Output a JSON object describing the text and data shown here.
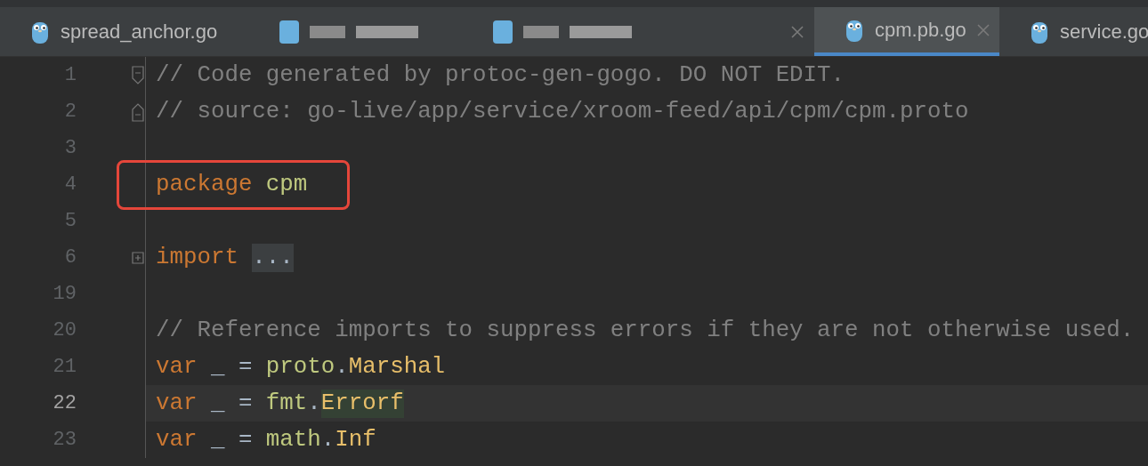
{
  "tabs": [
    {
      "kind": "file",
      "label": "spread_anchor.go",
      "selected": false,
      "closable": false
    },
    {
      "kind": "redacted",
      "selected": false,
      "closable": false
    },
    {
      "kind": "redacted",
      "selected": false,
      "closable": true
    },
    {
      "kind": "file",
      "label": "cpm.pb.go",
      "selected": true,
      "closable": true
    },
    {
      "kind": "file",
      "label": "service.go",
      "selected": false
    }
  ],
  "lines": [
    {
      "number": "1",
      "current": false,
      "fold": {
        "kind": "start"
      },
      "tokens": [
        {
          "kind": "comment",
          "text": "// Code generated by protoc-gen-gogo. DO NOT EDIT."
        }
      ]
    },
    {
      "number": "2",
      "current": false,
      "fold": {
        "kind": "end"
      },
      "tokens": [
        {
          "kind": "comment",
          "text": "// source: go-live/app/service/xroom-feed/api/cpm/cpm.proto"
        }
      ]
    },
    {
      "number": "3",
      "current": false
    },
    {
      "number": "4",
      "current": false,
      "boxed": true,
      "tokens": [
        {
          "kind": "keyword",
          "text": "package"
        },
        {
          "kind": "package",
          "text": "cpm",
          "spaced": true
        }
      ]
    },
    {
      "number": "5",
      "current": false
    },
    {
      "number": "6",
      "current": false,
      "fold": {
        "kind": "collapsed"
      },
      "tokens": [
        {
          "kind": "keyword",
          "text": "import"
        },
        {
          "kind": "folded",
          "text": "...",
          "spaced": true
        }
      ]
    },
    {
      "number": "19",
      "current": false
    },
    {
      "number": "20",
      "current": false,
      "tokens": [
        {
          "kind": "comment",
          "text": "// Reference imports to suppress errors if they are not otherwise used."
        }
      ]
    },
    {
      "number": "21",
      "current": false,
      "tokens": [
        {
          "kind": "keyword",
          "text": "var"
        },
        {
          "kind": "plain",
          "text": "_ =",
          "spaced": true
        },
        {
          "kind": "package",
          "text": "proto",
          "spaced": true
        },
        {
          "kind": "plain",
          "text": "."
        },
        {
          "kind": "function",
          "text": "Marshal"
        }
      ]
    },
    {
      "number": "22",
      "current": true,
      "tokens": [
        {
          "kind": "keyword",
          "text": "var"
        },
        {
          "kind": "plain",
          "text": "_ =",
          "spaced": true
        },
        {
          "kind": "package",
          "text": "fmt",
          "spaced": true
        },
        {
          "kind": "plain",
          "text": "."
        },
        {
          "kind": "highlight",
          "text": "Errorf"
        }
      ]
    },
    {
      "number": "23",
      "current": false,
      "tokens": [
        {
          "kind": "keyword",
          "text": "var"
        },
        {
          "kind": "plain",
          "text": "_ =",
          "spaced": true
        },
        {
          "kind": "package",
          "text": "math",
          "spaced": true
        },
        {
          "kind": "plain",
          "text": "."
        },
        {
          "kind": "function",
          "text": "Inf"
        }
      ]
    }
  ]
}
